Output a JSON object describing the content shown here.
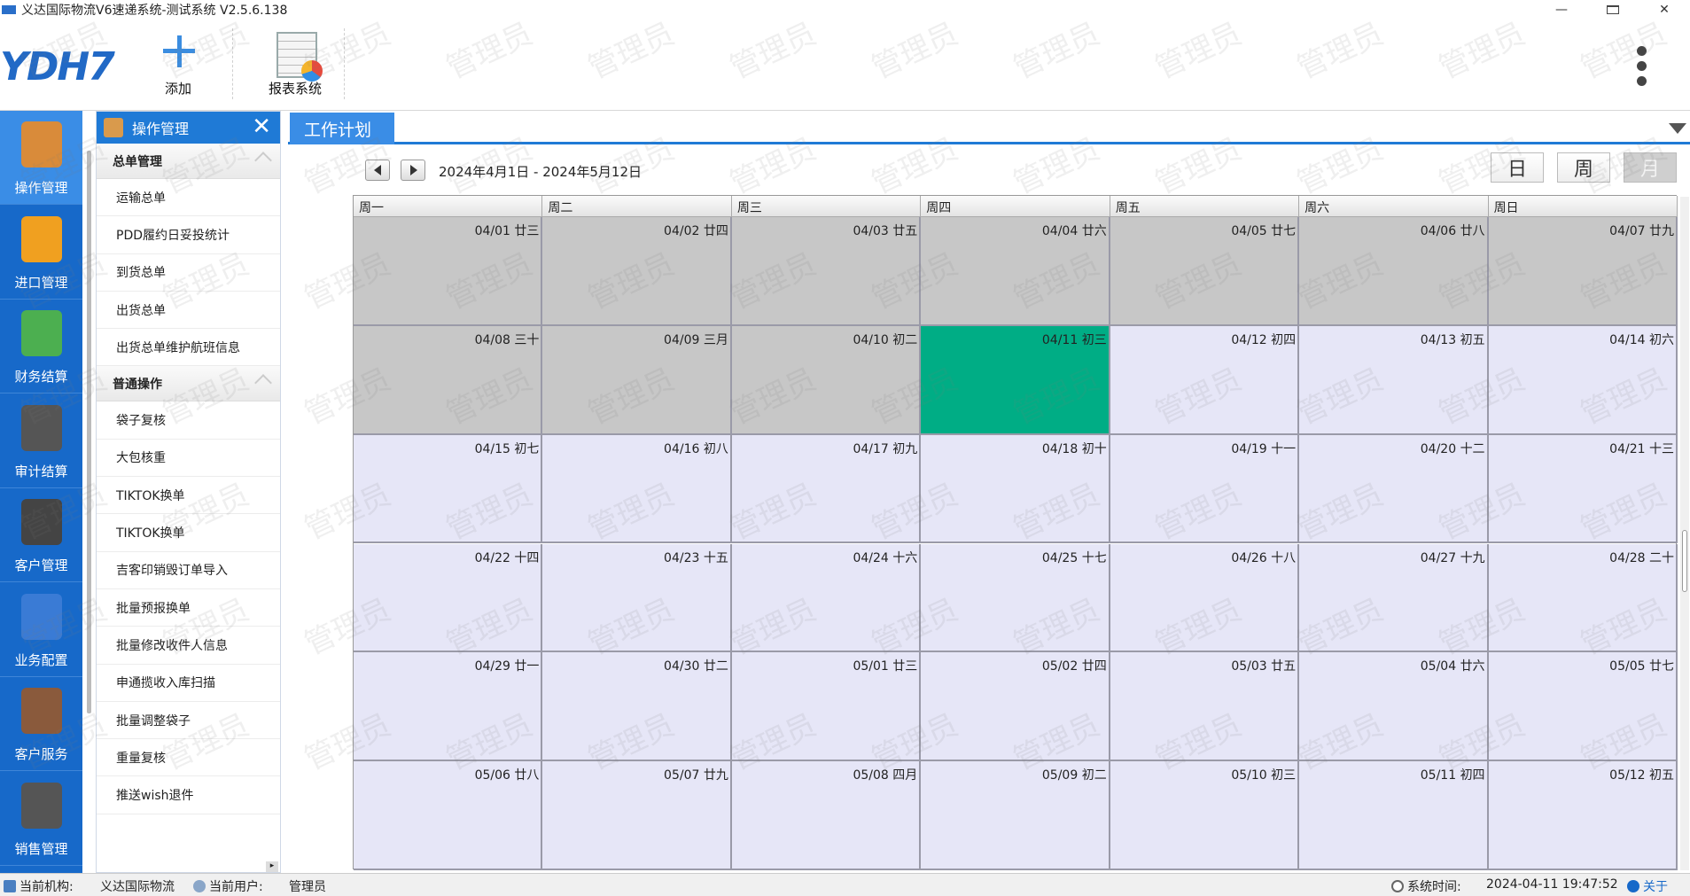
{
  "window": {
    "title": "义达国际物流V6速递系统-测试系统 V2.5.6.138"
  },
  "toolbar": {
    "logo_text": "YDH7",
    "add_label": "添加",
    "report_label": "报表系统"
  },
  "modules": [
    {
      "label": "操作管理",
      "icon": "courier-person-icon"
    },
    {
      "label": "进口管理",
      "icon": "truck-icon"
    },
    {
      "label": "财务结算",
      "icon": "finance-chart-money-icon"
    },
    {
      "label": "审计结算",
      "icon": "auditor-person-icon"
    },
    {
      "label": "客户管理",
      "icon": "customer-person-icon"
    },
    {
      "label": "业务配置",
      "icon": "config-window-gear-icon"
    },
    {
      "label": "客户服务",
      "icon": "headset-person-icon"
    },
    {
      "label": "销售管理",
      "icon": "sales-person-icon"
    }
  ],
  "nav": {
    "title": "操作管理",
    "groups": [
      {
        "label": "总单管理",
        "items": [
          "运输总单",
          "PDD履约日妥投统计",
          "到货总单",
          "出货总单",
          "出货总单维护航班信息"
        ]
      },
      {
        "label": "普通操作",
        "items": [
          "袋子复核",
          "大包核重",
          "TIKTOK换单",
          "TIKTOK换单",
          "吉客印销毁订单导入",
          "批量预报换单",
          "批量修改收件人信息",
          "申通揽收入库扫描",
          "批量调整袋子",
          "重量复核",
          "推送wish退件"
        ]
      }
    ]
  },
  "main": {
    "tab_label": "工作计划",
    "date_range": "2024年4月1日 - 2024年5月12日",
    "views": {
      "day": "日",
      "week": "周",
      "month": "月",
      "active": "month"
    }
  },
  "calendar": {
    "weekdays": [
      "周一",
      "周二",
      "周三",
      "周四",
      "周五",
      "周六",
      "周日"
    ],
    "weeks": [
      [
        {
          "date": "04/01",
          "lunar": "廿三",
          "state": "past"
        },
        {
          "date": "04/02",
          "lunar": "廿四",
          "state": "past"
        },
        {
          "date": "04/03",
          "lunar": "廿五",
          "state": "past"
        },
        {
          "date": "04/04",
          "lunar": "廿六",
          "state": "past"
        },
        {
          "date": "04/05",
          "lunar": "廿七",
          "state": "past"
        },
        {
          "date": "04/06",
          "lunar": "廿八",
          "state": "past"
        },
        {
          "date": "04/07",
          "lunar": "廿九",
          "state": "past"
        }
      ],
      [
        {
          "date": "04/08",
          "lunar": "三十",
          "state": "past"
        },
        {
          "date": "04/09",
          "lunar": "三月",
          "state": "past"
        },
        {
          "date": "04/10",
          "lunar": "初二",
          "state": "past"
        },
        {
          "date": "04/11",
          "lunar": "初三",
          "state": "today"
        },
        {
          "date": "04/12",
          "lunar": "初四",
          "state": "future"
        },
        {
          "date": "04/13",
          "lunar": "初五",
          "state": "future"
        },
        {
          "date": "04/14",
          "lunar": "初六",
          "state": "future"
        }
      ],
      [
        {
          "date": "04/15",
          "lunar": "初七",
          "state": "future"
        },
        {
          "date": "04/16",
          "lunar": "初八",
          "state": "future"
        },
        {
          "date": "04/17",
          "lunar": "初九",
          "state": "future"
        },
        {
          "date": "04/18",
          "lunar": "初十",
          "state": "future"
        },
        {
          "date": "04/19",
          "lunar": "十一",
          "state": "future"
        },
        {
          "date": "04/20",
          "lunar": "十二",
          "state": "future"
        },
        {
          "date": "04/21",
          "lunar": "十三",
          "state": "future"
        }
      ],
      [
        {
          "date": "04/22",
          "lunar": "十四",
          "state": "future"
        },
        {
          "date": "04/23",
          "lunar": "十五",
          "state": "future"
        },
        {
          "date": "04/24",
          "lunar": "十六",
          "state": "future"
        },
        {
          "date": "04/25",
          "lunar": "十七",
          "state": "future"
        },
        {
          "date": "04/26",
          "lunar": "十八",
          "state": "future"
        },
        {
          "date": "04/27",
          "lunar": "十九",
          "state": "future"
        },
        {
          "date": "04/28",
          "lunar": "二十",
          "state": "future"
        }
      ],
      [
        {
          "date": "04/29",
          "lunar": "廿一",
          "state": "future"
        },
        {
          "date": "04/30",
          "lunar": "廿二",
          "state": "future"
        },
        {
          "date": "05/01",
          "lunar": "廿三",
          "state": "future"
        },
        {
          "date": "05/02",
          "lunar": "廿四",
          "state": "future"
        },
        {
          "date": "05/03",
          "lunar": "廿五",
          "state": "future"
        },
        {
          "date": "05/04",
          "lunar": "廿六",
          "state": "future"
        },
        {
          "date": "05/05",
          "lunar": "廿七",
          "state": "future"
        }
      ],
      [
        {
          "date": "05/06",
          "lunar": "廿八",
          "state": "future"
        },
        {
          "date": "05/07",
          "lunar": "廿九",
          "state": "future"
        },
        {
          "date": "05/08",
          "lunar": "四月",
          "state": "future"
        },
        {
          "date": "05/09",
          "lunar": "初二",
          "state": "future"
        },
        {
          "date": "05/10",
          "lunar": "初三",
          "state": "future"
        },
        {
          "date": "05/11",
          "lunar": "初四",
          "state": "future"
        },
        {
          "date": "05/12",
          "lunar": "初五",
          "state": "future"
        }
      ]
    ],
    "colors": {
      "past": "#c7c7c7",
      "today": "#00ad85",
      "future": "#e6e6f7"
    }
  },
  "watermark": "管理员",
  "status": {
    "org_label": "当前机构:",
    "org_value": "义达国际物流",
    "user_label": "当前用户:",
    "user_value": "管理员",
    "time_label": "系统时间:",
    "time_value": "2024-04-11 19:47:52",
    "about": "关于"
  }
}
